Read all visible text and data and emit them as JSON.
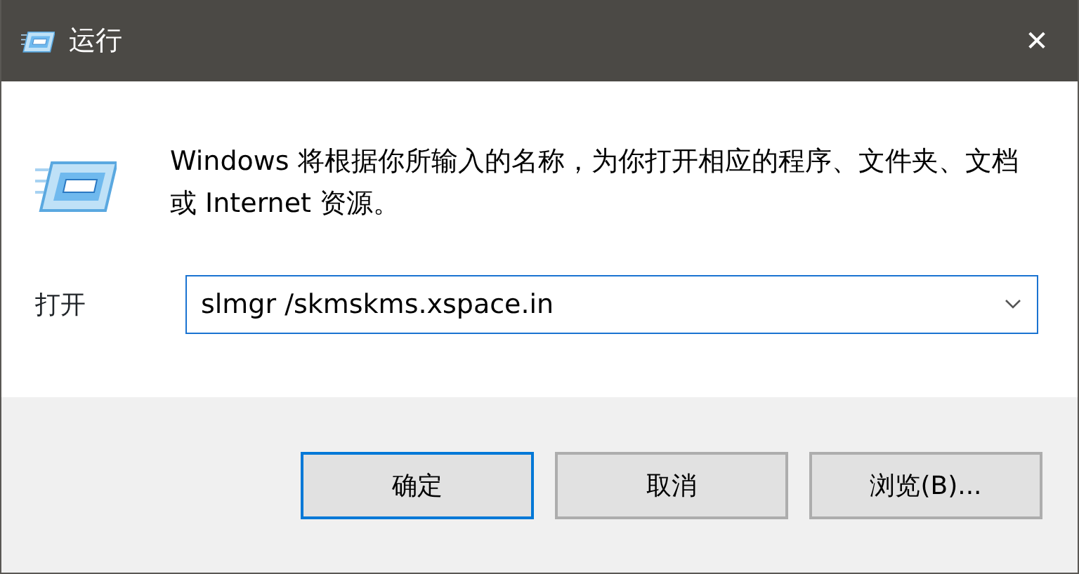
{
  "window": {
    "title": "运行",
    "close": "✕"
  },
  "message": "Windows 将根据你所输入的名称，为你打开相应的程序、文件夹、文档或 Internet 资源。",
  "open_field": {
    "label": "打开",
    "value": "slmgr /skmskms.xspace.in"
  },
  "buttons": [
    {
      "label": "确定",
      "default": true
    },
    {
      "label": "取消",
      "default": false
    },
    {
      "label": "浏览(B)...",
      "default": false
    }
  ]
}
